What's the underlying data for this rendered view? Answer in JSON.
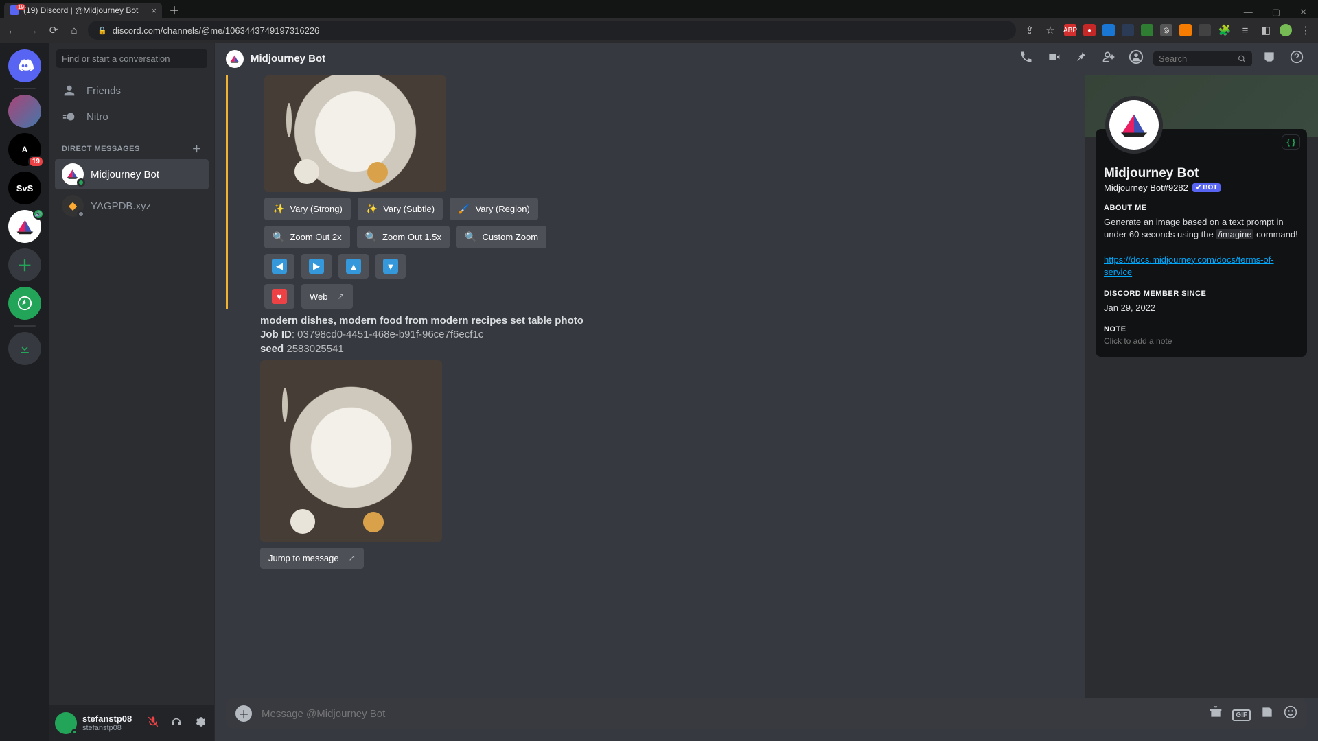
{
  "browser": {
    "tab_title": "(19) Discord | @Midjourney Bot",
    "url": "discord.com/channels/@me/1063443749197316226"
  },
  "guilds": {
    "explore_badge": "19",
    "svs_label": "SvS"
  },
  "dm_col": {
    "find_placeholder": "Find or start a conversation",
    "friends_label": "Friends",
    "nitro_label": "Nitro",
    "dm_heading": "DIRECT MESSAGES",
    "items": [
      {
        "name": "Midjourney Bot"
      },
      {
        "name": "YAGPDB.xyz"
      }
    ]
  },
  "user_panel": {
    "name": "stefanstp08",
    "tag": "stefanstp08"
  },
  "chat_header": {
    "title": "Midjourney Bot",
    "search_placeholder": "Search"
  },
  "message": {
    "vary_strong": "Vary (Strong)",
    "vary_subtle": "Vary (Subtle)",
    "vary_region": "Vary (Region)",
    "zoom_2x": "Zoom Out 2x",
    "zoom_15x": "Zoom Out 1.5x",
    "custom_zoom": "Custom Zoom",
    "web_label": "Web",
    "jump_label": "Jump to message",
    "prompt_text": "modern dishes, modern food from modern recipes set table photo",
    "job_id_label": "Job ID",
    "job_id_value": ": 03798cd0-4451-468e-b91f-96ce7f6ecf1c",
    "seed_label": "seed",
    "seed_value": " 2583025541"
  },
  "input": {
    "placeholder": "Message @Midjourney Bot"
  },
  "profile": {
    "name": "Midjourney Bot",
    "discrim": "Midjourney Bot#9282",
    "bot_chip": "BOT",
    "about_heading": "ABOUT ME",
    "about_text_1": "Generate an image based on a text prompt in under 60 seconds using the ",
    "about_cmd": "/imagine",
    "about_text_2": " command!",
    "tos_link": "https://docs.midjourney.com/docs/terms-of-service",
    "member_since_heading": "DISCORD MEMBER SINCE",
    "member_since_value": "Jan 29, 2022",
    "note_heading": "NOTE",
    "note_placeholder": "Click to add a note",
    "dev_badge": "{ }"
  }
}
